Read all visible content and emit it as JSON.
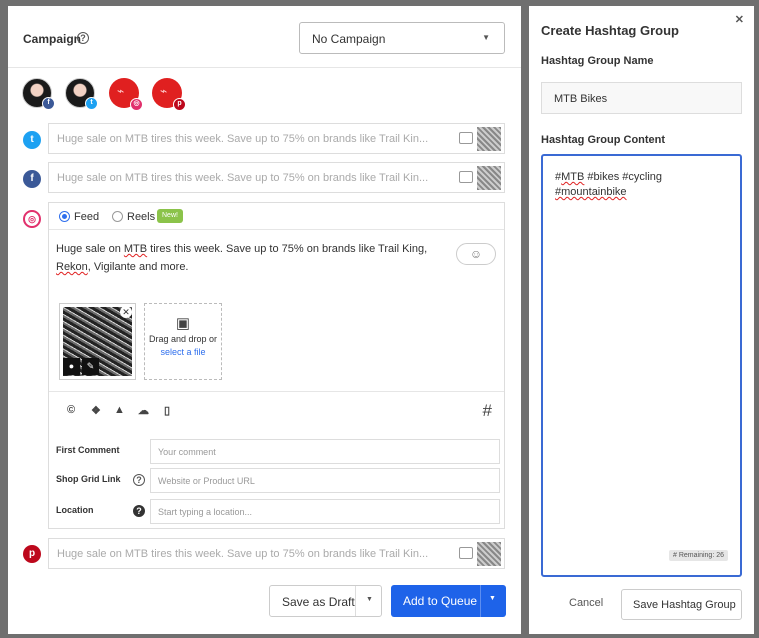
{
  "campaign": {
    "label": "Campaign",
    "selected": "No Campaign"
  },
  "networks": {
    "twitter_icon": "twitter-icon",
    "facebook_icon": "facebook-icon",
    "instagram_icon": "instagram-icon",
    "pinterest_icon": "pinterest-icon"
  },
  "preview_text": "Huge sale on MTB tires this week. Save up to 75% on brands like Trail Kin...",
  "instagram": {
    "tab_feed": "Feed",
    "tab_reels": "Reels",
    "new_badge": "New!",
    "post_before": "Huge sale on ",
    "post_mtb": "MTB",
    "post_middle": " tires this week. Save up to 75% on brands like Trail King, ",
    "post_rekon": "Rekon",
    "post_after": ", Vigilante and more.",
    "drop_text": "Drag and drop or",
    "drop_link": "select a file",
    "hashtag_tool": "#",
    "fields": {
      "first_comment_label": "First Comment",
      "first_comment_placeholder": "Your comment",
      "shop_grid_label": "Shop Grid Link",
      "shop_grid_placeholder": "Website or Product URL",
      "location_label": "Location",
      "location_placeholder": "Start typing a location..."
    }
  },
  "actions": {
    "save_draft": "Save as Draft",
    "add_queue": "Add to Queue"
  },
  "hashtag_panel": {
    "title": "Create Hashtag Group",
    "name_label": "Hashtag Group Name",
    "name_value": "MTB Bikes",
    "content_label": "Hashtag Group Content",
    "content_line1_prefix": "#",
    "content_line1_mtb": "MTB",
    "content_line1_rest": " #bikes #cycling",
    "content_line2": "#mountainbike",
    "remaining": "# Remaining: 26",
    "cancel": "Cancel",
    "save": "Save Hashtag Group"
  },
  "colors": {
    "accent": "#1e63e9",
    "twitter": "#1da1f2",
    "facebook": "#3b5998",
    "instagram": "#e1306c",
    "pinterest": "#bd081c",
    "new_badge": "#8bc34a"
  }
}
